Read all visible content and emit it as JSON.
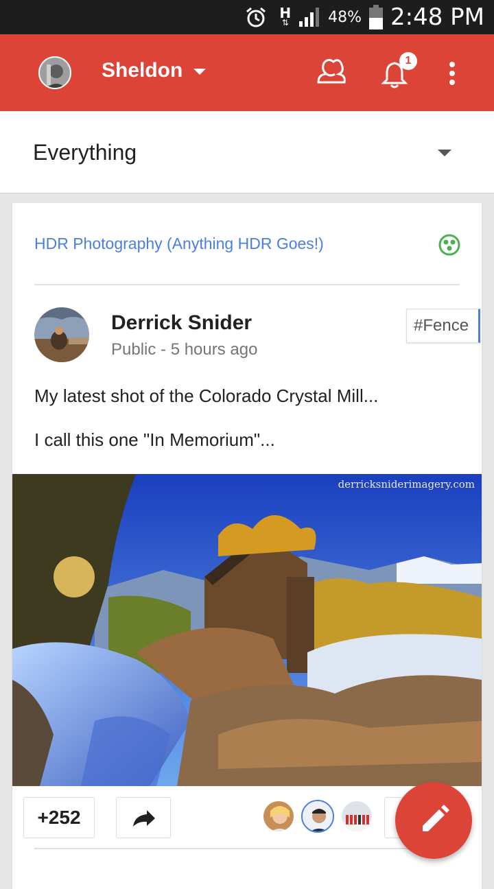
{
  "status_bar": {
    "battery": "48%",
    "time": "2:48 PM",
    "network": "H"
  },
  "app_bar": {
    "account_name": "Sheldon",
    "notification_count": "1"
  },
  "filter": {
    "label": "Everything"
  },
  "post": {
    "community": "HDR Photography (Anything HDR Goes!)",
    "author": "Derrick Snider",
    "meta": "Public - 5 hours ago",
    "hashtag": "#Fence",
    "line1": "My latest shot of the Colorado Crystal Mill...",
    "line2": "I call this one \"In Memorium\"...",
    "watermark": "derricksniderimagery.com",
    "plus_count": "+252"
  },
  "colors": {
    "brand_red": "#db4437",
    "link_blue": "#4a7ee3",
    "community_green": "#4caf50"
  }
}
